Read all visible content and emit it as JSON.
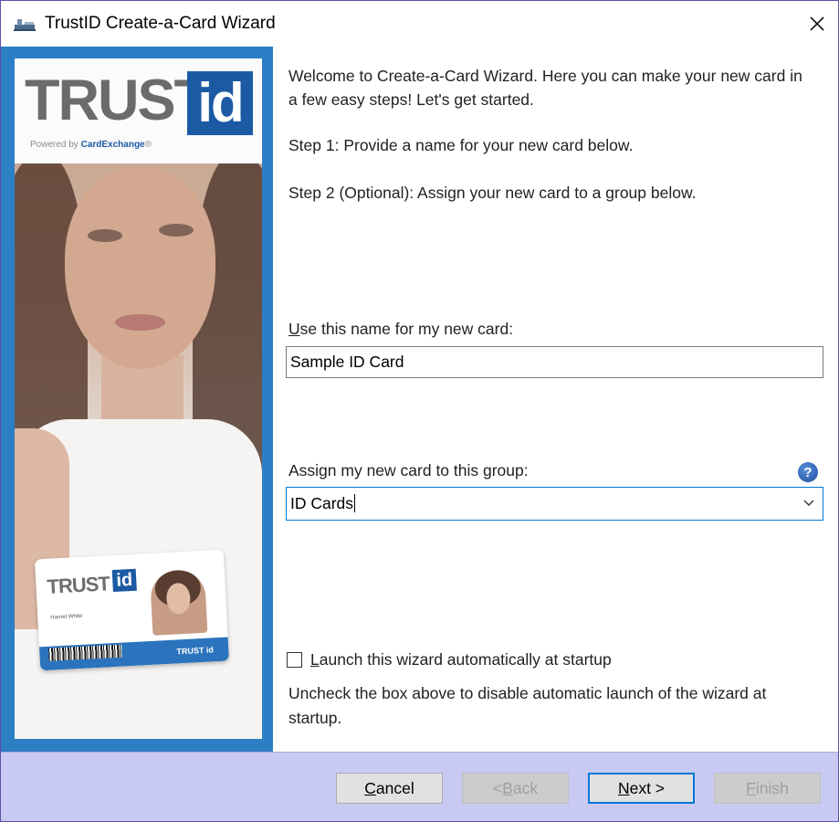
{
  "window": {
    "title": "TrustID Create-a-Card Wizard"
  },
  "branding": {
    "logo_trust": "TRUST",
    "logo_id": "id",
    "powered_by": "Powered by",
    "powered_by_brand": "CardExchange",
    "powered_by_mark": "®",
    "card_logo_trust": "TRUST",
    "card_logo_id": "id",
    "card_holder_name": "Harriet White",
    "card_footer_logo": "TRUST id"
  },
  "content": {
    "welcome": "Welcome to Create-a-Card Wizard. Here you can make your new card in a few easy steps! Let's get started.",
    "step1": "Step 1:  Provide a name for your new card below.",
    "step2": "Step 2 (Optional):  Assign your new card to a group below."
  },
  "name_field": {
    "label_first": "U",
    "label_rest": "se this name for my new card:",
    "value": "Sample ID Card"
  },
  "group_field": {
    "label_before": "Assign my new card to this ",
    "label_underlined": "g",
    "label_after": "roup:",
    "value": "ID Cards",
    "help_icon": "?"
  },
  "startup": {
    "checked": false,
    "label_first": "L",
    "label_rest": "aunch this wizard automatically at startup",
    "hint": "Uncheck the box above to disable automatic launch of the wizard at startup."
  },
  "buttons": {
    "cancel_first": "C",
    "cancel_rest": "ancel",
    "back_before": "< ",
    "back_first": "B",
    "back_rest": "ack",
    "next_first": "N",
    "next_rest": "ext >",
    "finish_first": "F",
    "finish_rest": "inish"
  },
  "colors": {
    "accent": "#0078d7",
    "brand_blue": "#2d7fc5",
    "footer_bg": "#c8caf3"
  }
}
